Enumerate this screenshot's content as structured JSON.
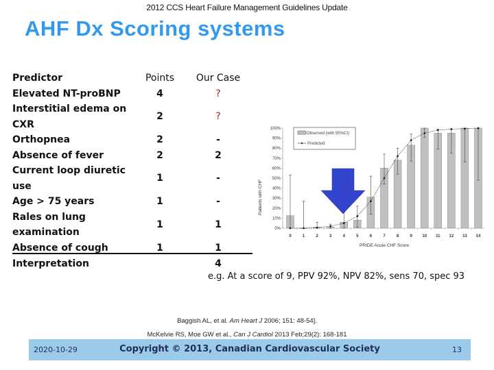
{
  "header": {
    "title": "2012 CCS Heart Failure Management Guidelines Update"
  },
  "slide": {
    "title": "AHF Dx Scoring systems"
  },
  "table": {
    "columns": [
      "Predictor",
      "Points",
      "Our Case"
    ],
    "rows": [
      {
        "predictor": "Elevated NT-proBNP",
        "points": "4",
        "case": "?"
      },
      {
        "predictor": "Interstitial edema on CXR",
        "points": "2",
        "case": "?"
      },
      {
        "predictor": "Orthopnea",
        "points": "2",
        "case": "-"
      },
      {
        "predictor": "Absence of fever",
        "points": "2",
        "case": "2"
      },
      {
        "predictor": "Current loop diuretic use",
        "points": "1",
        "case": "-"
      },
      {
        "predictor": "Age > 75 years",
        "points": "1",
        "case": "-"
      },
      {
        "predictor": "Rales on lung examination",
        "points": "1",
        "case": "1"
      },
      {
        "predictor": "Absence of cough",
        "points": "1",
        "case": "1"
      }
    ],
    "interpretation": {
      "label": "Interpretation",
      "case": "4"
    },
    "question_color": "#b02020"
  },
  "example_text": "e.g. At a score of 9, PPV 92%, NPV 82%, sens 70, spec 93",
  "references": {
    "ref1_authors": "Baggish AL, et al. ",
    "ref1_journal": "Am Heart J",
    "ref1_rest": " 2006; 151: 48-54].",
    "ref2_authors": "McKelvie RS, Moe GW et al., ",
    "ref2_journal": "Can J Cardiol",
    "ref2_rest": " 2013 Feb;29(2): 168-181"
  },
  "footer": {
    "date": "2020-10-29",
    "copyright": "Copyright © 2013, Canadian Cardiovascular Society",
    "page": "13"
  },
  "chart_data": {
    "type": "bar",
    "title": "",
    "xlabel": "PRIDE Acute CHF Score",
    "ylabel": "Patients with CHF",
    "ylim": [
      0,
      100
    ],
    "yticks": [
      "0%",
      "10%",
      "20%",
      "30%",
      "40%",
      "50%",
      "60%",
      "70%",
      "80%",
      "90%",
      "100%"
    ],
    "categories": [
      "0",
      "1",
      "2",
      "3",
      "4",
      "5",
      "6",
      "7",
      "8",
      "9",
      "10",
      "11",
      "12",
      "13",
      "14"
    ],
    "legend": [
      "Observed (with 95%CI)",
      "Predicted"
    ],
    "legend_position": "top-left",
    "series": [
      {
        "name": "Observed (with 95%CI)",
        "kind": "bar",
        "values": [
          12.5,
          0,
          1,
          1,
          6,
          8,
          31,
          60,
          68,
          83,
          100,
          95,
          95,
          100,
          100
        ],
        "ci_low": [
          0,
          0,
          0,
          0,
          0,
          1,
          14,
          44,
          54,
          67,
          91,
          79,
          75,
          66,
          48
        ],
        "ci_high": [
          53,
          27,
          6,
          4,
          16,
          22,
          52,
          74,
          80,
          94,
          100,
          99,
          99,
          100,
          100
        ]
      },
      {
        "name": "Predicted",
        "kind": "line",
        "values": [
          0,
          0,
          0.5,
          2,
          5,
          12,
          27,
          50,
          72,
          88,
          95,
          98,
          99,
          99.5,
          100
        ]
      }
    ],
    "bar_color": "#c0c0c0",
    "annotation": {
      "kind": "arrow",
      "points_to_category": "4",
      "color": "#3344cc"
    }
  }
}
